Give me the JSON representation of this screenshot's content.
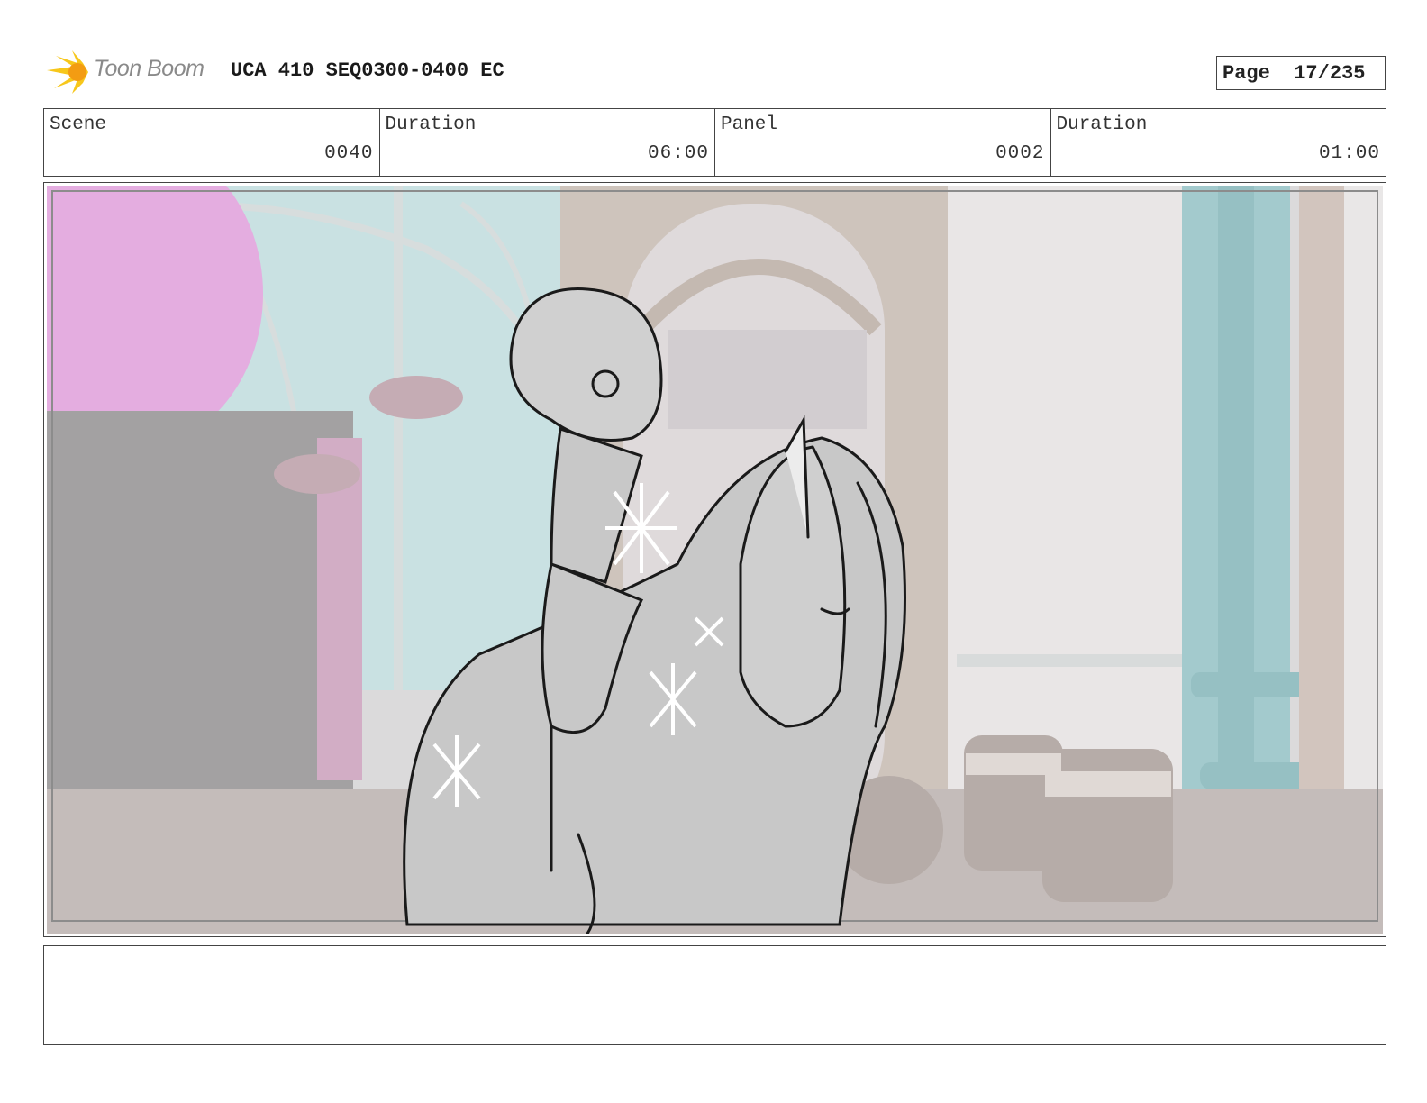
{
  "header": {
    "logo_text": "Toon Boom",
    "title": "UCA 410 SEQ0300-0400 EC",
    "page_label": "Page",
    "page_value": "17/235"
  },
  "info": {
    "scene_label": "Scene",
    "scene_value": "0040",
    "scene_duration_label": "Duration",
    "scene_duration_value": "06:00",
    "panel_label": "Panel",
    "panel_value": "0002",
    "panel_duration_label": "Duration",
    "panel_duration_value": "01:00"
  },
  "colors": {
    "logo_yellow": "#f7c71b",
    "logo_orange": "#f39c12",
    "wall_teal": "#9cc9cc",
    "banner_pink": "#d98ad3",
    "floor": "#b7aeab",
    "pillar_teal": "#7fb3b6"
  },
  "notes": ""
}
